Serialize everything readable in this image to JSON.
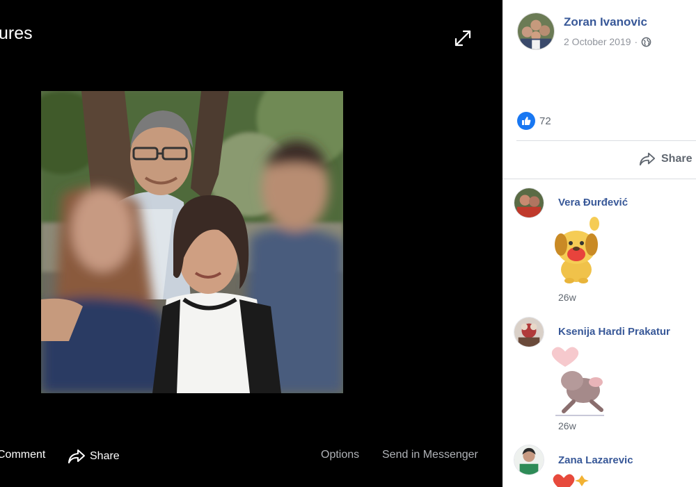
{
  "viewer": {
    "title": "ures",
    "actions": {
      "comment": "Comment",
      "share": "Share",
      "options": "Options",
      "send_messenger": "Send in Messenger"
    }
  },
  "post": {
    "author": "Zoran Ivanovic",
    "date": "2 October 2019",
    "separator": "·",
    "privacy_icon": "globe-icon",
    "like_icon": "thumbs-up-icon",
    "like_count": "72",
    "share_label": "Share"
  },
  "comments": [
    {
      "name": "Vera Đurđević",
      "sticker": "dog-waving-sticker",
      "time": "26w"
    },
    {
      "name": "Ksenija Hardi Prakatur",
      "sticker": "dog-heart-sticker",
      "time": "26w"
    },
    {
      "name": "Zana Lazarevic",
      "sticker": "hearts-sticker"
    }
  ],
  "colors": {
    "viewer_bg": "#000000",
    "link_blue": "#385898",
    "like_blue": "#1877f2",
    "muted_text": "#606770"
  }
}
